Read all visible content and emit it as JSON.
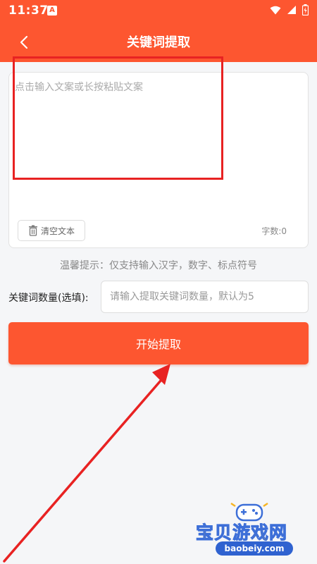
{
  "status_bar": {
    "time": "11:37",
    "notification_badge": "A"
  },
  "header": {
    "title": "关键词提取"
  },
  "input_card": {
    "placeholder": "点击输入文案或长按粘贴文案",
    "clear_label": "清空文本",
    "char_count": "字数:0"
  },
  "tip": "温馨提示：仅支持输入汉字，数字、标点符号",
  "keyword_count": {
    "label": "关键词数量(选填):",
    "placeholder": "请输入提取关键词数量，默认为5"
  },
  "start_button": {
    "label": "开始提取"
  },
  "watermark": {
    "text": "宝贝游戏网",
    "url": "baobeiy.com"
  },
  "colors": {
    "primary": "#fd5630",
    "highlight": "#e82222",
    "background": "#f5f6f8"
  },
  "icons": [
    "back-chevron-icon",
    "wifi-icon",
    "signal-icon",
    "battery-icon",
    "trash-icon"
  ]
}
